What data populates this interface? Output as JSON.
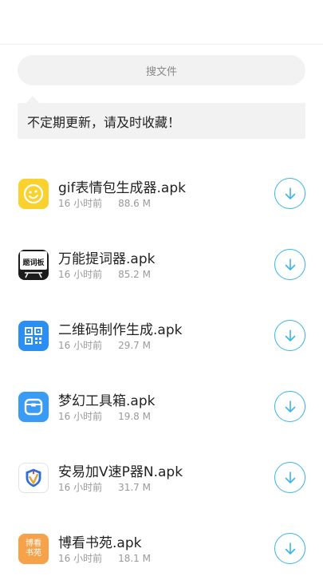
{
  "search": {
    "placeholder": "搜文件"
  },
  "notice": {
    "text": "不定期更新，请及时收藏！"
  },
  "files": [
    {
      "name": "gif表情包生成器.apk",
      "time": "16 小时前",
      "size": "88.6 M",
      "icon": "smiley-face-icon",
      "color": "#f9d230"
    },
    {
      "name": "万能提词器.apk",
      "time": "16 小时前",
      "size": "85.2 M",
      "icon": "teleprompter-icon",
      "color": "#1c1c1c",
      "icon_text": "题词板"
    },
    {
      "name": "二维码制作生成.apk",
      "time": "16 小时前",
      "size": "29.7 M",
      "icon": "qr-code-icon",
      "color": "#2b8ef3"
    },
    {
      "name": "梦幻工具箱.apk",
      "time": "16 小时前",
      "size": "19.8 M",
      "icon": "toolbox-icon",
      "color": "#3a9bf5"
    },
    {
      "name": "安易加V速P器N.apk",
      "time": "16 小时前",
      "size": "31.7 M",
      "icon": "shield-icon",
      "color": "#ffffff"
    },
    {
      "name": "博看书苑.apk",
      "time": "16 小时前",
      "size": "18.1 M",
      "icon": "book-logo-icon",
      "color": "#f5a24a",
      "icon_text": "博看 书苑"
    }
  ],
  "colors": {
    "accent": "#3bb4e8",
    "panel": "#f2f2f2"
  }
}
